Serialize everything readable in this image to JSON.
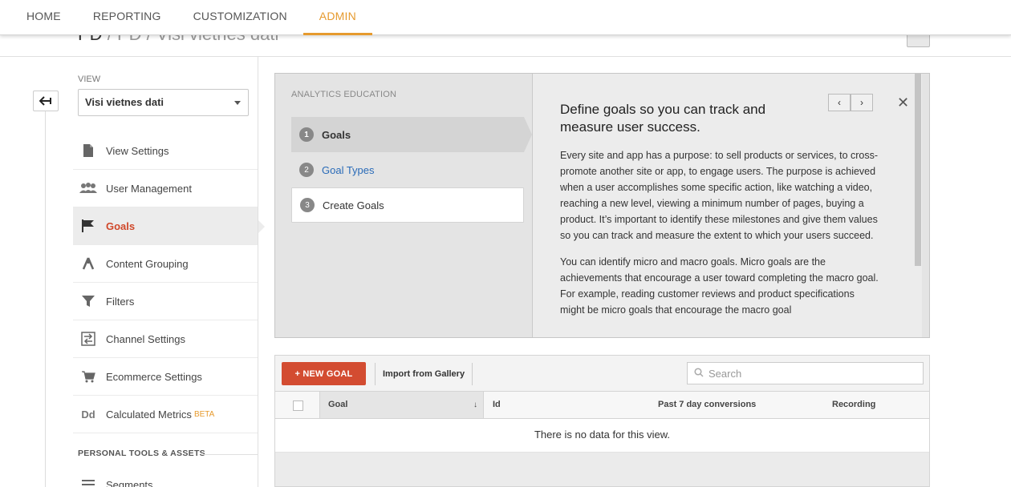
{
  "topnav": {
    "tabs": [
      {
        "label": "HOME"
      },
      {
        "label": "REPORTING"
      },
      {
        "label": "CUSTOMIZATION"
      },
      {
        "label": "ADMIN",
        "active": true
      }
    ]
  },
  "breadcrumb": {
    "root": "PD",
    "sep1": "/",
    "account": "PD",
    "sep2": "/",
    "view": "Visi vietnes dati"
  },
  "sidebar": {
    "view_label": "VIEW",
    "view_selected": "Visi vietnes dati",
    "items": [
      {
        "label": "View Settings",
        "icon": "document-icon"
      },
      {
        "label": "User Management",
        "icon": "users-icon"
      },
      {
        "label": "Goals",
        "icon": "flag-icon",
        "active": true
      },
      {
        "label": "Content Grouping",
        "icon": "grouping-icon"
      },
      {
        "label": "Filters",
        "icon": "filter-icon"
      },
      {
        "label": "Channel Settings",
        "icon": "channel-icon"
      },
      {
        "label": "Ecommerce Settings",
        "icon": "cart-icon"
      },
      {
        "label": "Calculated Metrics",
        "icon": "dd-icon",
        "badge": "BETA"
      }
    ],
    "section_title": "PERSONAL TOOLS & ASSETS",
    "partial_item": "Segments"
  },
  "education": {
    "title": "ANALYTICS EDUCATION",
    "steps": [
      {
        "num": "1",
        "label": "Goals"
      },
      {
        "num": "2",
        "label": "Goal Types"
      },
      {
        "num": "3",
        "label": "Create Goals"
      }
    ],
    "heading": "Define goals so you can track and measure user success.",
    "paragraph1": "Every site and app has a purpose: to sell products or services, to cross-promote another site or app, to engage users. The purpose is achieved when a user accomplishes some specific action, like watching a video, reaching a new level, viewing a minimum number of pages, buying a product. It’s important to identify these milestones and give them values so you can track and measure the extent to which your users succeed.",
    "paragraph2": "You can identify micro and macro goals. Micro goals are the achievements that encourage a user toward completing the macro goal. For example, reading customer reviews and product specifications might be micro goals that encourage the macro goal",
    "prev": "‹",
    "next": "›",
    "close": "✕"
  },
  "goals_table": {
    "new_goal_label": "+ NEW GOAL",
    "import_label": "Import from Gallery",
    "search_placeholder": "Search",
    "columns": {
      "goal": "Goal",
      "id": "Id",
      "conversions": "Past 7 day conversions",
      "recording": "Recording"
    },
    "empty_message": "There is no data for this view."
  },
  "colors": {
    "accent_admin": "#e69a2e",
    "active_menu": "#d0482a",
    "new_goal_button": "#d34c31",
    "link": "#2a6bb8"
  }
}
